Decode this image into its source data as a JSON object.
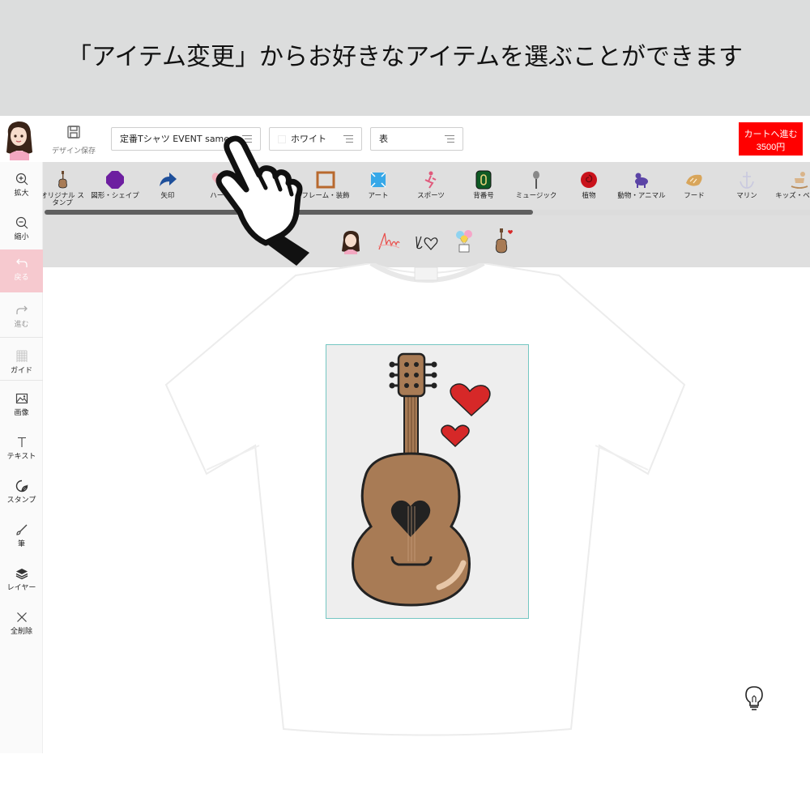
{
  "banner": {
    "text": "「アイテム変更」からお好きなアイテムを選ぶことができます"
  },
  "toolbar": {
    "save_label": "デザイン保存",
    "product_select": "定番Tシャツ EVENT same",
    "color_select": "ホワイト",
    "side_select": "表",
    "cart_line1": "カートへ進む",
    "cart_line2": "3500円"
  },
  "sidebar": {
    "items": [
      {
        "label": "拡大",
        "icon": "zoom-in-icon"
      },
      {
        "label": "縮小",
        "icon": "zoom-out-icon"
      },
      {
        "label": "戻る",
        "icon": "undo-icon"
      },
      {
        "label": "進む",
        "icon": "redo-icon"
      },
      {
        "label": "ガイド",
        "icon": "grid-icon"
      },
      {
        "label": "画像",
        "icon": "image-icon"
      },
      {
        "label": "テキスト",
        "icon": "text-icon"
      },
      {
        "label": "スタンプ",
        "icon": "sticker-icon"
      },
      {
        "label": "筆",
        "icon": "brush-icon"
      },
      {
        "label": "レイヤー",
        "icon": "layers-icon"
      },
      {
        "label": "全削除",
        "icon": "close-icon"
      }
    ]
  },
  "categories": [
    {
      "label": "オリジナル スタンプ"
    },
    {
      "label": "図形・シェイプ"
    },
    {
      "label": "矢印"
    },
    {
      "label": "ハート"
    },
    {
      "label": "フレーム・装飾"
    },
    {
      "label": "アート"
    },
    {
      "label": "スポーツ"
    },
    {
      "label": "背番号"
    },
    {
      "label": "ミュージック"
    },
    {
      "label": "植物"
    },
    {
      "label": "動物・アニマル"
    },
    {
      "label": "フード"
    },
    {
      "label": "マリン"
    },
    {
      "label": "キッズ・ベビー"
    }
  ],
  "colors": {
    "cart": "#ff0000",
    "undo_active": "#f6c9cf",
    "banner_bg": "#dcdddd",
    "category_bg": "#dfdfdf",
    "design_border": "#74c6c2",
    "guitar_body": "#a87b55",
    "heart": "#d62828"
  }
}
